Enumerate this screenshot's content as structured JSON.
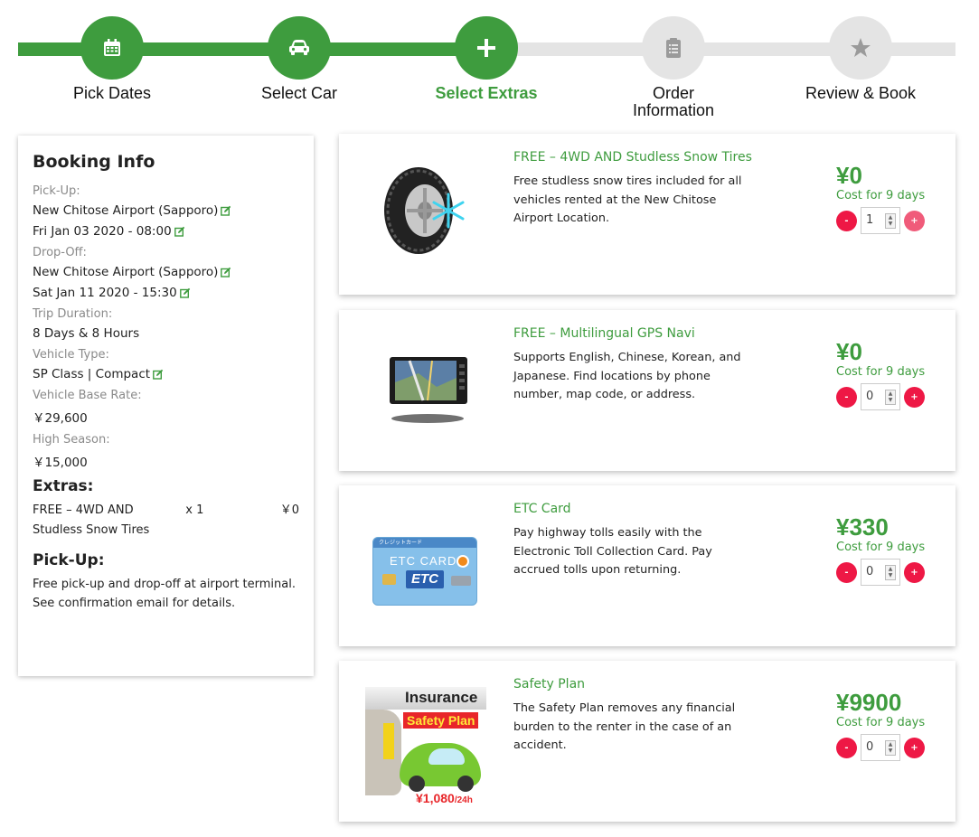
{
  "stepper": {
    "steps": [
      {
        "label": "Pick Dates",
        "icon": "calendar-icon",
        "state": "complete"
      },
      {
        "label": "Select Car",
        "icon": "car-icon",
        "state": "complete"
      },
      {
        "label": "Select Extras",
        "icon": "plus-icon",
        "state": "current"
      },
      {
        "label": "Order Information",
        "icon": "clipboard-icon",
        "state": "pending"
      },
      {
        "label": "Review & Book",
        "icon": "star-icon",
        "state": "pending"
      }
    ]
  },
  "booking": {
    "title": "Booking Info",
    "pickup_label": "Pick-Up:",
    "pickup_location": "New Chitose Airport (Sapporo)",
    "pickup_time": "Fri Jan 03 2020 - 08:00",
    "dropoff_label": "Drop-Off:",
    "dropoff_location": "New Chitose Airport (Sapporo)",
    "dropoff_time": "Sat Jan 11 2020 - 15:30",
    "duration_label": "Trip Duration:",
    "duration_value": "8 Days & 8 Hours",
    "vehicle_type_label": "Vehicle Type:",
    "vehicle_type_value": "SP Class | Compact",
    "base_rate_label": "Vehicle Base Rate:",
    "base_rate_value": "￥29,600",
    "high_season_label": "High Season:",
    "high_season_value": "￥15,000",
    "extras_title": "Extras:",
    "extras": [
      {
        "name": "FREE – 4WD AND Studless Snow Tires",
        "qty": "x 1",
        "price": "￥0"
      }
    ],
    "pickup_note_title": "Pick-Up:",
    "pickup_note": "Free pick-up and drop-off at airport terminal. See confirmation email for details."
  },
  "extras": [
    {
      "title": "FREE – 4WD AND Studless Snow Tires",
      "description": "Free studless snow tires included for all vehicles rented at the New Chitose Airport Location.",
      "price": "¥0",
      "cost_note": "Cost for 9 days",
      "quantity": "1",
      "minus": "-",
      "plus": "+",
      "image": "snow-tire-image"
    },
    {
      "title": "FREE – Multilingual GPS Navi",
      "description": "Supports English, Chinese, Korean, and Japanese. Find locations by phone number, map code, or address.",
      "price": "¥0",
      "cost_note": "Cost for 9 days",
      "quantity": "0",
      "minus": "-",
      "plus": "+",
      "image": "gps-navi-image"
    },
    {
      "title": "ETC Card",
      "description": "Pay highway tolls easily with the Electronic Toll Collection Card. Pay accrued tolls upon returning.",
      "price": "¥330",
      "cost_note": "Cost for 9 days",
      "quantity": "0",
      "minus": "-",
      "plus": "+",
      "image": "etc-card-image",
      "image_text": {
        "top": "クレジットカード",
        "card_label": "ETC CARD",
        "logo": "ETC"
      }
    },
    {
      "title": "Safety Plan",
      "description": "The Safety Plan removes any financial burden to the renter in the case of an accident.",
      "price": "¥9900",
      "cost_note": "Cost for 9 days",
      "quantity": "0",
      "minus": "-",
      "plus": "+",
      "image": "safety-plan-image",
      "image_text": {
        "line1": "Insurance",
        "line2": "Safety Plan",
        "price": "¥1,080",
        "unit": "/24h"
      }
    }
  ],
  "colors": {
    "accent": "#3e9c3e",
    "inactive": "#e4e4e4",
    "stepper_button": "#ee1845"
  }
}
